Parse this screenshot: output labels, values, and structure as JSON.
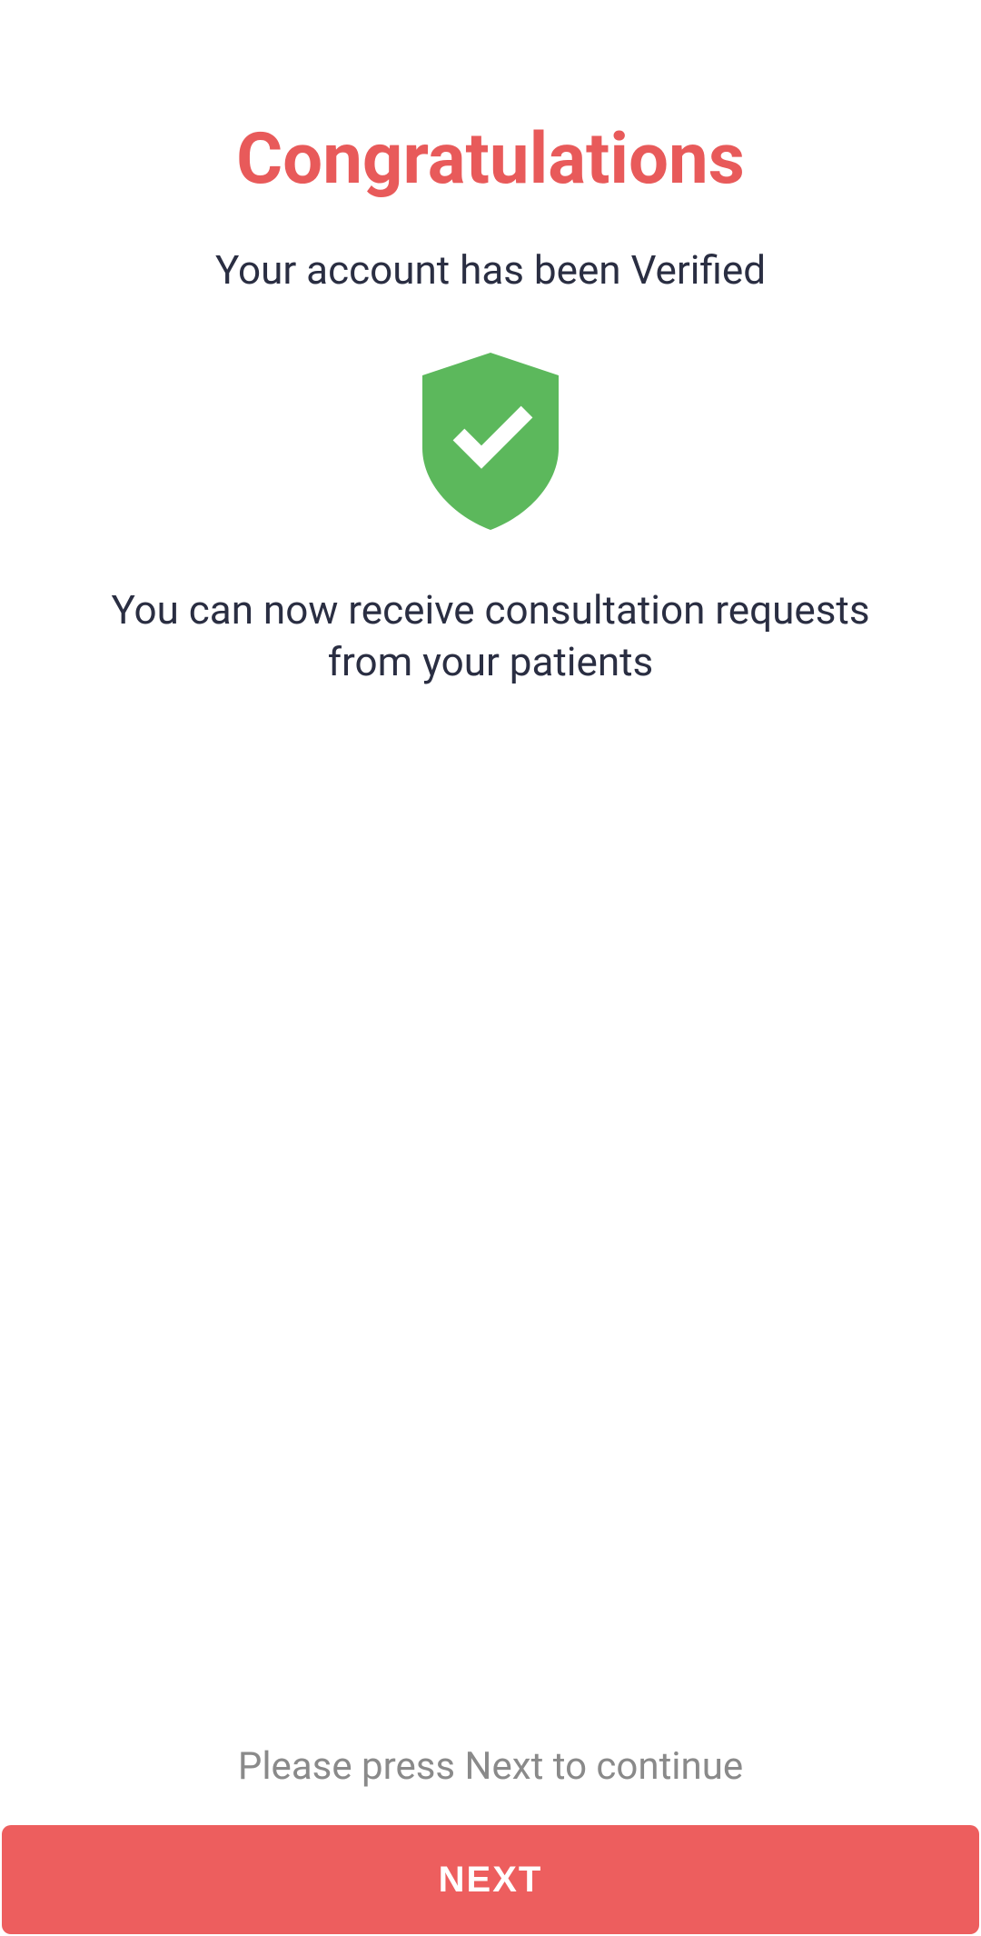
{
  "header": {
    "title": "Congratulations",
    "subtitle": "Your account has been Verified"
  },
  "body": {
    "description": "You can now receive consultation requests from your patients"
  },
  "footer": {
    "hint": "Please press Next to continue",
    "button_label": "NEXT"
  },
  "colors": {
    "accent": "#e85a5a",
    "button": "#ed5e5e",
    "shield": "#5cb85c",
    "text_dark": "#2a2e42",
    "text_muted": "#8a8a8a"
  }
}
